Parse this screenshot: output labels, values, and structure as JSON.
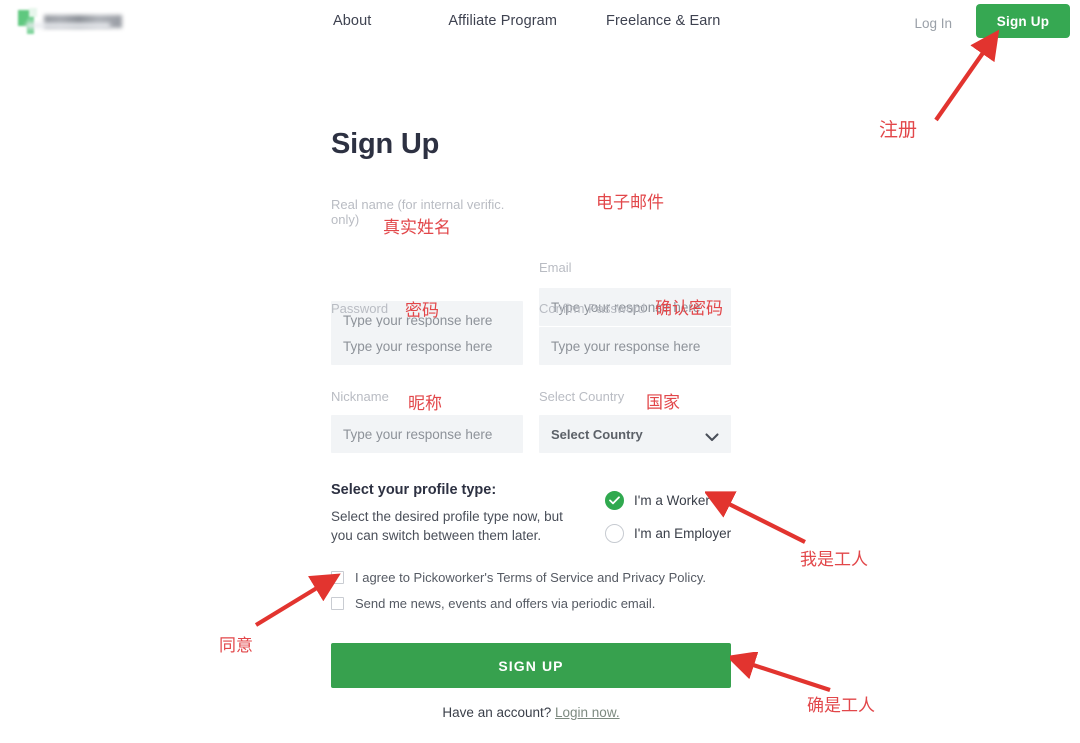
{
  "header": {
    "logo_alt": "site-logo",
    "nav": [
      {
        "label": "About"
      },
      {
        "label": "Affiliate Program"
      },
      {
        "label": "Freelance & Earn"
      }
    ],
    "login_label": "Log In",
    "signup_label": "Sign Up"
  },
  "form": {
    "title": "Sign Up",
    "fields": {
      "real_name": {
        "label": "Real name (for internal verific. only)",
        "placeholder": "Type your response here",
        "value": ""
      },
      "email": {
        "label": "Email",
        "placeholder": "Type your response here",
        "value": ""
      },
      "password": {
        "label": "Password",
        "placeholder": "Type your response here",
        "value": ""
      },
      "confirm_password": {
        "label": "Confirm Password",
        "placeholder": "Type your response here",
        "value": ""
      },
      "nickname": {
        "label": "Nickname",
        "placeholder": "Type your response here",
        "value": ""
      },
      "country": {
        "label": "Select Country",
        "selected": "Select Country",
        "chevron_icon": "chevron-down-icon"
      }
    },
    "profile_type": {
      "title": "Select your profile type:",
      "description": "Select the desired profile type now, but you can switch between them later.",
      "options": [
        {
          "label": "I'm a Worker",
          "selected": true
        },
        {
          "label": "I'm an Employer",
          "selected": false
        }
      ]
    },
    "agreements": [
      {
        "label": "I agree to Pickoworker's Terms of Service and Privacy Policy.",
        "checked": false
      },
      {
        "label": "Send me news, events and offers via periodic email.",
        "checked": false
      }
    ],
    "submit_label": "SIGN UP",
    "footer_text": "Have an account?",
    "footer_link": "Login now."
  },
  "annotations": [
    {
      "id": "a1",
      "text": "注册",
      "meaning": "register"
    },
    {
      "id": "a2",
      "text": "真实姓名",
      "meaning": "real name"
    },
    {
      "id": "a3",
      "text": "电子邮件",
      "meaning": "email"
    },
    {
      "id": "a4",
      "text": "密码",
      "meaning": "password"
    },
    {
      "id": "a5",
      "text": "确认密码",
      "meaning": "confirm password"
    },
    {
      "id": "a6",
      "text": "昵称",
      "meaning": "nickname"
    },
    {
      "id": "a7",
      "text": "国家",
      "meaning": "country"
    },
    {
      "id": "a8",
      "text": "我是工人",
      "meaning": "I am a worker"
    },
    {
      "id": "a9",
      "text": "同意",
      "meaning": "agree"
    },
    {
      "id": "a10",
      "text": "确是工人",
      "meaning": "confirm worker"
    }
  ],
  "colors": {
    "brand_green": "#36a852",
    "submit_green": "#37a14e",
    "annotation_red": "#e2474a",
    "input_bg": "#f2f4f6",
    "label_gray": "#b9bcc3"
  }
}
